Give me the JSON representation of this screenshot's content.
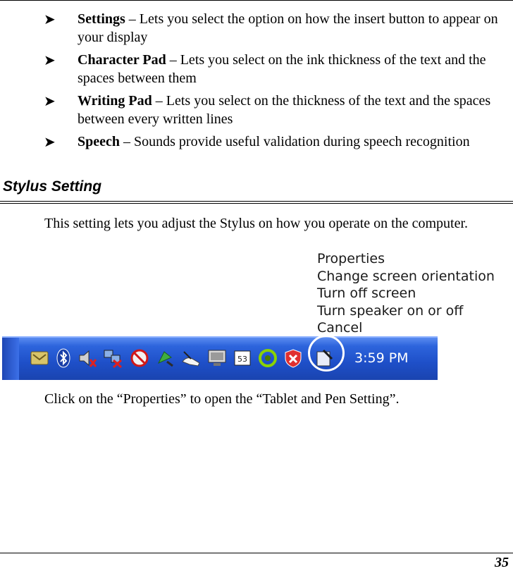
{
  "bullets": [
    {
      "term": "Settings",
      "text": " – Lets you select the option on how the insert button to appear on your display"
    },
    {
      "term": "Character Pad",
      "text": " – Lets you select on the ink thickness of the text and the spaces between them"
    },
    {
      "term": "Writing Pad",
      "text": " – Lets you select on the thickness of the text and the spaces between every written lines"
    },
    {
      "term": "Speech",
      "text": " – Sounds provide useful validation during speech recognition"
    }
  ],
  "section": {
    "heading": "Stylus Setting",
    "paragraph": "This setting lets you adjust the Stylus on how you operate on the computer."
  },
  "context_menu": {
    "items": [
      "Properties",
      "Change screen orientation",
      "Turn off screen",
      "Turn speaker on or off",
      "Cancel"
    ]
  },
  "taskbar": {
    "clock": "3:59 PM",
    "tray_icons": [
      "network-folder-icon",
      "bluetooth-icon",
      "speaker-muted-icon",
      "network-disconnected-icon",
      "no-entry-icon",
      "safely-remove-hardware-icon",
      "pen-hand-icon",
      "display-icon",
      "media-icon",
      "recycle-icon",
      "security-shield-icon",
      "tablet-pen-icon"
    ],
    "colors": {
      "bar": "#1e4fc8",
      "highlight": "#ffffff"
    }
  },
  "caption": "Click on the “Properties” to open the “Tablet and Pen Setting”.",
  "page_number": "35"
}
